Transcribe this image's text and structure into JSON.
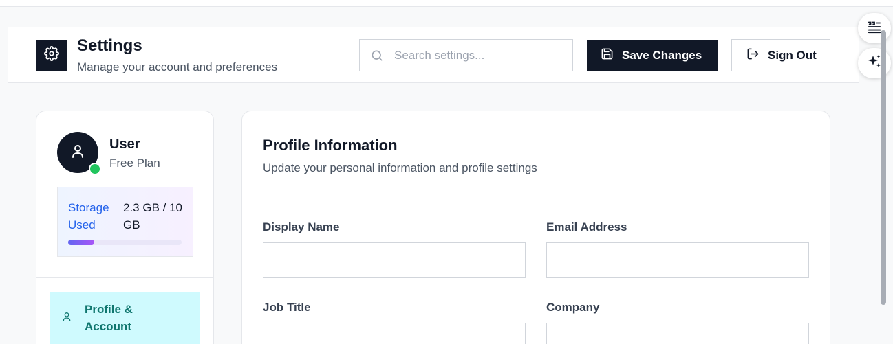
{
  "header": {
    "title": "Settings",
    "subtitle": "Manage your account and preferences",
    "logo_icon": "gear-icon",
    "search": {
      "placeholder": "Search settings...",
      "value": "",
      "icon": "search-icon"
    },
    "save_button": {
      "label": "Save Changes",
      "icon": "floppy-disk-icon"
    },
    "signout_button": {
      "label": "Sign Out",
      "icon": "logout-icon"
    }
  },
  "floating": [
    {
      "icon": "quote-list-icon"
    },
    {
      "icon": "sparkles-icon"
    }
  ],
  "sidebar": {
    "user": {
      "name": "User",
      "plan": "Free Plan",
      "avatar_icon": "user-icon",
      "status": "online",
      "status_color": "#22c55e"
    },
    "storage": {
      "label": "Storage Used",
      "value": "2.3 GB / 10 GB",
      "used_fraction": 0.23
    },
    "nav": [
      {
        "label": "Profile & Account",
        "icon": "user-icon",
        "active": true
      }
    ]
  },
  "main": {
    "section_title": "Profile Information",
    "section_subtitle": "Update your personal information and profile settings",
    "fields": [
      {
        "label": "Display Name",
        "value": ""
      },
      {
        "label": "Email Address",
        "value": ""
      },
      {
        "label": "Job Title",
        "value": ""
      },
      {
        "label": "Company",
        "value": ""
      }
    ]
  },
  "colors": {
    "primary": "#111827",
    "accent_cyan": "#cffafe",
    "accent_teal_text": "#0f766e",
    "link_blue": "#2563eb"
  }
}
